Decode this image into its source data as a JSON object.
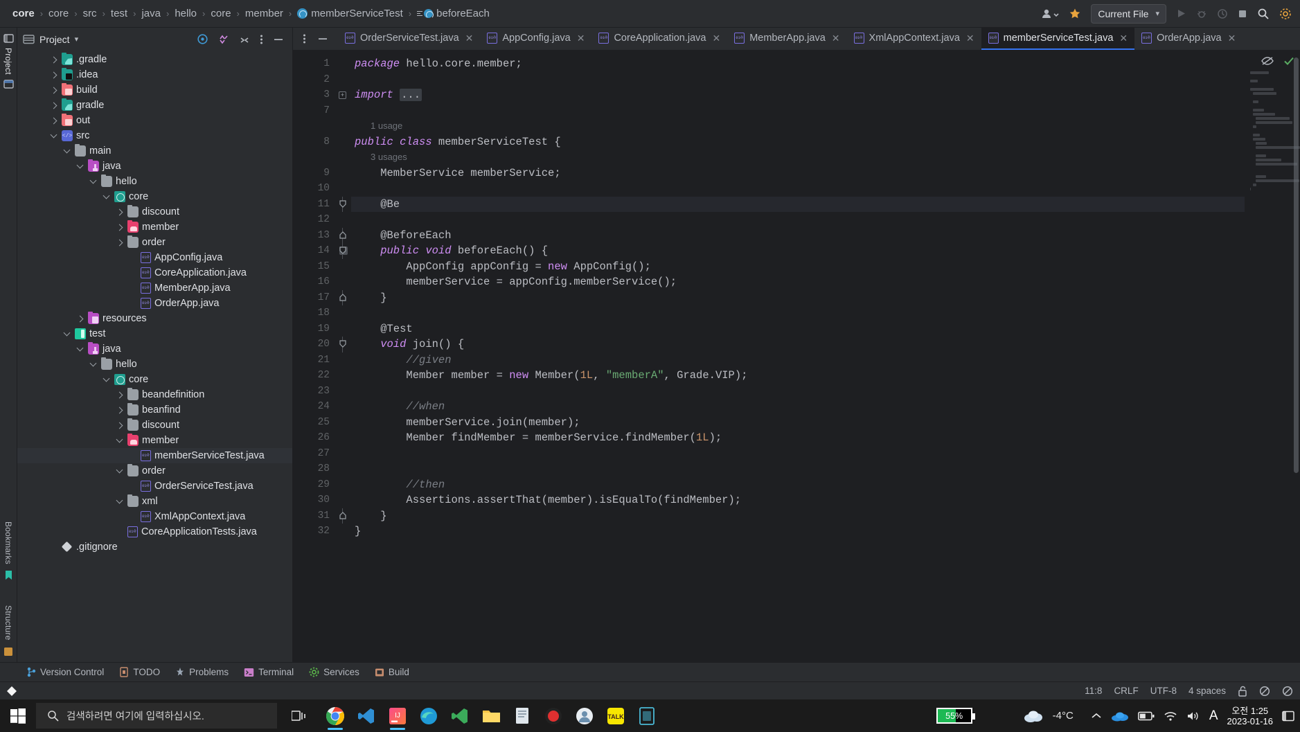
{
  "breadcrumb": {
    "items": [
      {
        "label": "core",
        "icon": "none",
        "bold": true
      },
      {
        "label": "core",
        "icon": "none",
        "bold": false
      },
      {
        "label": "src",
        "icon": "none",
        "bold": false
      },
      {
        "label": "test",
        "icon": "none",
        "bold": false
      },
      {
        "label": "java",
        "icon": "none",
        "bold": false
      },
      {
        "label": "hello",
        "icon": "none",
        "bold": false
      },
      {
        "label": "core",
        "icon": "none",
        "bold": false
      },
      {
        "label": "member",
        "icon": "none",
        "bold": false
      },
      {
        "label": "memberServiceTest",
        "icon": "class-icon",
        "bold": false
      },
      {
        "label": "beforeEach",
        "icon": "method-icon",
        "bold": false
      }
    ],
    "separator": "›"
  },
  "topbar": {
    "run_config_label": "Current File",
    "chevron": "▾",
    "icons": [
      "user-group-icon",
      "updates-icon",
      "run-icon",
      "debug-icon",
      "profile-icon",
      "stop-icon",
      "search-icon",
      "settings-icon"
    ]
  },
  "project_panel": {
    "title": "Project",
    "chevron": "▾",
    "header_icons": [
      "target-locate-icon",
      "expand-all-icon",
      "collapse-all-icon",
      "more-options-icon",
      "hide-panel-icon"
    ],
    "tree": [
      {
        "label": ".gradle",
        "indent": 1,
        "arrow": "right",
        "icon": "gradle",
        "selected": false
      },
      {
        "label": ".idea",
        "indent": 1,
        "arrow": "right",
        "icon": "idea",
        "selected": false
      },
      {
        "label": "build",
        "indent": 1,
        "arrow": "right",
        "icon": "red",
        "selected": false
      },
      {
        "label": "gradle",
        "indent": 1,
        "arrow": "right",
        "icon": "gradle",
        "selected": false
      },
      {
        "label": "out",
        "indent": 1,
        "arrow": "right",
        "icon": "red",
        "selected": false
      },
      {
        "label": "src",
        "indent": 1,
        "arrow": "down",
        "icon": "src",
        "selected": false
      },
      {
        "label": "main",
        "indent": 2,
        "arrow": "down",
        "icon": "folder",
        "selected": false
      },
      {
        "label": "java",
        "indent": 3,
        "arrow": "down",
        "icon": "javaf",
        "selected": false
      },
      {
        "label": "hello",
        "indent": 4,
        "arrow": "down",
        "icon": "folder",
        "selected": false
      },
      {
        "label": "core",
        "indent": 5,
        "arrow": "down",
        "icon": "corepkg",
        "selected": false
      },
      {
        "label": "discount",
        "indent": 6,
        "arrow": "right",
        "icon": "folder",
        "selected": false
      },
      {
        "label": "member",
        "indent": 6,
        "arrow": "right",
        "icon": "memberf",
        "selected": false
      },
      {
        "label": "order",
        "indent": 6,
        "arrow": "right",
        "icon": "folder",
        "selected": false
      },
      {
        "label": "AppConfig.java",
        "indent": 7,
        "arrow": "none",
        "icon": "javafile",
        "selected": false
      },
      {
        "label": "CoreApplication.java",
        "indent": 7,
        "arrow": "none",
        "icon": "javafile",
        "selected": false
      },
      {
        "label": "MemberApp.java",
        "indent": 7,
        "arrow": "none",
        "icon": "javafile",
        "selected": false
      },
      {
        "label": "OrderApp.java",
        "indent": 7,
        "arrow": "none",
        "icon": "javafile",
        "selected": false
      },
      {
        "label": "resources",
        "indent": 3,
        "arrow": "right",
        "icon": "resourcesf",
        "selected": false
      },
      {
        "label": "test",
        "indent": 2,
        "arrow": "down",
        "icon": "testf",
        "selected": false
      },
      {
        "label": "java",
        "indent": 3,
        "arrow": "down",
        "icon": "javaf",
        "selected": false
      },
      {
        "label": "hello",
        "indent": 4,
        "arrow": "down",
        "icon": "folder",
        "selected": false
      },
      {
        "label": "core",
        "indent": 5,
        "arrow": "down",
        "icon": "corepkg",
        "selected": false
      },
      {
        "label": "beandefinition",
        "indent": 6,
        "arrow": "right",
        "icon": "folder",
        "selected": false
      },
      {
        "label": "beanfind",
        "indent": 6,
        "arrow": "right",
        "icon": "folder",
        "selected": false
      },
      {
        "label": "discount",
        "indent": 6,
        "arrow": "right",
        "icon": "folder",
        "selected": false
      },
      {
        "label": "member",
        "indent": 6,
        "arrow": "down",
        "icon": "memberf",
        "selected": false
      },
      {
        "label": "memberServiceTest.java",
        "indent": 7,
        "arrow": "none",
        "icon": "javafile",
        "selected": true
      },
      {
        "label": "order",
        "indent": 6,
        "arrow": "down",
        "icon": "folder",
        "selected": false
      },
      {
        "label": "OrderServiceTest.java",
        "indent": 7,
        "arrow": "none",
        "icon": "javafile",
        "selected": false
      },
      {
        "label": "xml",
        "indent": 6,
        "arrow": "down",
        "icon": "folder",
        "selected": false
      },
      {
        "label": "XmlAppContext.java",
        "indent": 7,
        "arrow": "none",
        "icon": "javafile",
        "selected": false
      },
      {
        "label": "CoreApplicationTests.java",
        "indent": 6,
        "arrow": "none",
        "icon": "javafile",
        "selected": false
      },
      {
        "label": ".gitignore",
        "indent": 1,
        "arrow": "none",
        "icon": "gitign",
        "selected": false
      }
    ]
  },
  "left_strip": {
    "items": [
      "Project",
      "Bookmarks",
      "Structure"
    ]
  },
  "editor": {
    "tabs": [
      {
        "label": "OrderServiceTest.java",
        "active": false,
        "close": "✕"
      },
      {
        "label": "AppConfig.java",
        "active": false,
        "close": "✕"
      },
      {
        "label": "CoreApplication.java",
        "active": false,
        "close": "✕"
      },
      {
        "label": "MemberApp.java",
        "active": false,
        "close": "✕"
      },
      {
        "label": "XmlAppContext.java",
        "active": false,
        "close": "✕"
      },
      {
        "label": "memberServiceTest.java",
        "active": true,
        "close": "✕"
      },
      {
        "label": "OrderApp.java",
        "active": false,
        "close": "✕"
      }
    ],
    "lines": [
      {
        "num": "1",
        "fold": "none",
        "cur": false,
        "hint": null,
        "tokens": [
          {
            "t": "package ",
            "c": "kw"
          },
          {
            "t": "hello.core.member;",
            "c": ""
          }
        ]
      },
      {
        "num": "2",
        "fold": "none",
        "cur": false,
        "hint": null,
        "tokens": []
      },
      {
        "num": "3",
        "fold": "plus",
        "cur": false,
        "hint": null,
        "tokens": [
          {
            "t": "import ",
            "c": "kw"
          },
          {
            "t": "...",
            "c": "chip"
          }
        ]
      },
      {
        "num": "7",
        "fold": "none",
        "cur": false,
        "hint": null,
        "tokens": []
      },
      {
        "num": "8",
        "fold": "none",
        "cur": false,
        "hint": "1 usage",
        "tokens": [
          {
            "t": "public class ",
            "c": "kw"
          },
          {
            "t": "memberServiceTest {",
            "c": ""
          }
        ]
      },
      {
        "num": "9",
        "fold": "none",
        "cur": false,
        "hint": "3 usages",
        "tokens": [
          {
            "t": "    MemberService memberService;",
            "c": ""
          }
        ]
      },
      {
        "num": "10",
        "fold": "none",
        "cur": false,
        "hint": null,
        "tokens": []
      },
      {
        "num": "11",
        "fold": "minus",
        "cur": true,
        "hint": null,
        "tokens": [
          {
            "t": "    @Be",
            "c": ""
          }
        ]
      },
      {
        "num": "12",
        "fold": "none",
        "cur": false,
        "hint": null,
        "tokens": []
      },
      {
        "num": "13",
        "fold": "up",
        "cur": false,
        "hint": null,
        "tokens": [
          {
            "t": "    @BeforeEach",
            "c": ""
          }
        ]
      },
      {
        "num": "14",
        "fold": "minus",
        "cur": false,
        "hint": null,
        "gutter_mark": true,
        "tokens": [
          {
            "t": "    public void ",
            "c": "kw"
          },
          {
            "t": "beforeEach() {",
            "c": ""
          }
        ]
      },
      {
        "num": "15",
        "fold": "none",
        "cur": false,
        "hint": null,
        "tokens": [
          {
            "t": "        AppConfig appConfig = ",
            "c": ""
          },
          {
            "t": "new ",
            "c": "kw2"
          },
          {
            "t": "AppConfig();",
            "c": ""
          }
        ]
      },
      {
        "num": "16",
        "fold": "none",
        "cur": false,
        "hint": null,
        "tokens": [
          {
            "t": "        memberService = appConfig.memberService();",
            "c": ""
          }
        ]
      },
      {
        "num": "17",
        "fold": "up",
        "cur": false,
        "hint": null,
        "tokens": [
          {
            "t": "    }",
            "c": ""
          }
        ]
      },
      {
        "num": "18",
        "fold": "none",
        "cur": false,
        "hint": null,
        "tokens": []
      },
      {
        "num": "19",
        "fold": "none",
        "cur": false,
        "hint": null,
        "tokens": [
          {
            "t": "    @Test",
            "c": ""
          }
        ]
      },
      {
        "num": "20",
        "fold": "minus",
        "cur": false,
        "hint": null,
        "tokens": [
          {
            "t": "    void ",
            "c": "kw"
          },
          {
            "t": "join() {",
            "c": ""
          }
        ]
      },
      {
        "num": "21",
        "fold": "none",
        "cur": false,
        "hint": null,
        "tokens": [
          {
            "t": "        //given",
            "c": "cmt"
          }
        ]
      },
      {
        "num": "22",
        "fold": "none",
        "cur": false,
        "hint": null,
        "tokens": [
          {
            "t": "        Member member = ",
            "c": ""
          },
          {
            "t": "new ",
            "c": "kw2"
          },
          {
            "t": "Member(",
            "c": ""
          },
          {
            "t": "1L",
            "c": "num"
          },
          {
            "t": ", ",
            "c": ""
          },
          {
            "t": "\"memberA\"",
            "c": "str"
          },
          {
            "t": ", Grade.VIP);",
            "c": ""
          }
        ]
      },
      {
        "num": "23",
        "fold": "none",
        "cur": false,
        "hint": null,
        "tokens": []
      },
      {
        "num": "24",
        "fold": "none",
        "cur": false,
        "hint": null,
        "tokens": [
          {
            "t": "        //when",
            "c": "cmt"
          }
        ]
      },
      {
        "num": "25",
        "fold": "none",
        "cur": false,
        "hint": null,
        "tokens": [
          {
            "t": "        memberService.join(member);",
            "c": ""
          }
        ]
      },
      {
        "num": "26",
        "fold": "none",
        "cur": false,
        "hint": null,
        "tokens": [
          {
            "t": "        Member findMember = memberService.findMember(",
            "c": ""
          },
          {
            "t": "1L",
            "c": "num"
          },
          {
            "t": ");",
            "c": ""
          }
        ]
      },
      {
        "num": "27",
        "fold": "none",
        "cur": false,
        "hint": null,
        "tokens": []
      },
      {
        "num": "28",
        "fold": "none",
        "cur": false,
        "hint": null,
        "tokens": []
      },
      {
        "num": "29",
        "fold": "none",
        "cur": false,
        "hint": null,
        "tokens": [
          {
            "t": "        //then",
            "c": "cmt"
          }
        ]
      },
      {
        "num": "30",
        "fold": "none",
        "cur": false,
        "hint": null,
        "tokens": [
          {
            "t": "        Assertions.assertThat(member).isEqualTo(findMember);",
            "c": ""
          }
        ]
      },
      {
        "num": "31",
        "fold": "up",
        "cur": false,
        "hint": null,
        "tokens": [
          {
            "t": "    }",
            "c": ""
          }
        ]
      },
      {
        "num": "32",
        "fold": "none",
        "cur": false,
        "hint": null,
        "tokens": [
          {
            "t": "}",
            "c": ""
          }
        ]
      }
    ],
    "inspection_icons": [
      "hide-inspections-icon",
      "no-problems-checkmark-icon"
    ]
  },
  "bottom_tools": [
    {
      "label": "Version Control",
      "icon": "branch-icon"
    },
    {
      "label": "TODO",
      "icon": "todo-icon"
    },
    {
      "label": "Problems",
      "icon": "problems-icon"
    },
    {
      "label": "Terminal",
      "icon": "terminal-icon"
    },
    {
      "label": "Services",
      "icon": "services-gear-icon"
    },
    {
      "label": "Build",
      "icon": "build-icon"
    }
  ],
  "status_bar": {
    "left_icon": "ide-logo-icon",
    "caret_position": "11:8",
    "line_separator": "CRLF",
    "encoding": "UTF-8",
    "indent": "4 spaces",
    "lock_icon": "unlock-icon",
    "inspection_icon": "no-inspections-icon",
    "notifications_icon": "notifications-icon"
  },
  "taskbar": {
    "start_icon": "windows-start-icon",
    "search_placeholder": "검색하려면 여기에 입력하십시오.",
    "search_icon": "search-icon",
    "task_view_icon": "task-view-icon",
    "apps": [
      {
        "name": "chrome-icon",
        "running": true
      },
      {
        "name": "vscode-icon",
        "running": false
      },
      {
        "name": "intellij-idea-icon",
        "running": true
      },
      {
        "name": "edge-icon",
        "running": false
      },
      {
        "name": "vscode-insiders-icon",
        "running": false
      },
      {
        "name": "file-explorer-icon",
        "running": false
      },
      {
        "name": "notepad-icon",
        "running": false
      },
      {
        "name": "recorder-icon",
        "running": false
      },
      {
        "name": "teams-icon",
        "running": false
      },
      {
        "name": "kakaotalk-icon",
        "running": false
      },
      {
        "name": "app-icon",
        "running": false
      }
    ],
    "battery_percent": "55%",
    "battery_level": 55,
    "weather_temp": "-4°C",
    "weather_icon": "cloud-icon",
    "tray_icons": [
      "show-hidden-icons-chevron",
      "onedrive-icon",
      "battery-icon",
      "wifi-icon",
      "volume-icon",
      "ime-A-icon"
    ],
    "clock_time": "오전 1:25",
    "clock_date": "2023-01-16",
    "notification_icon": "action-center-icon"
  }
}
